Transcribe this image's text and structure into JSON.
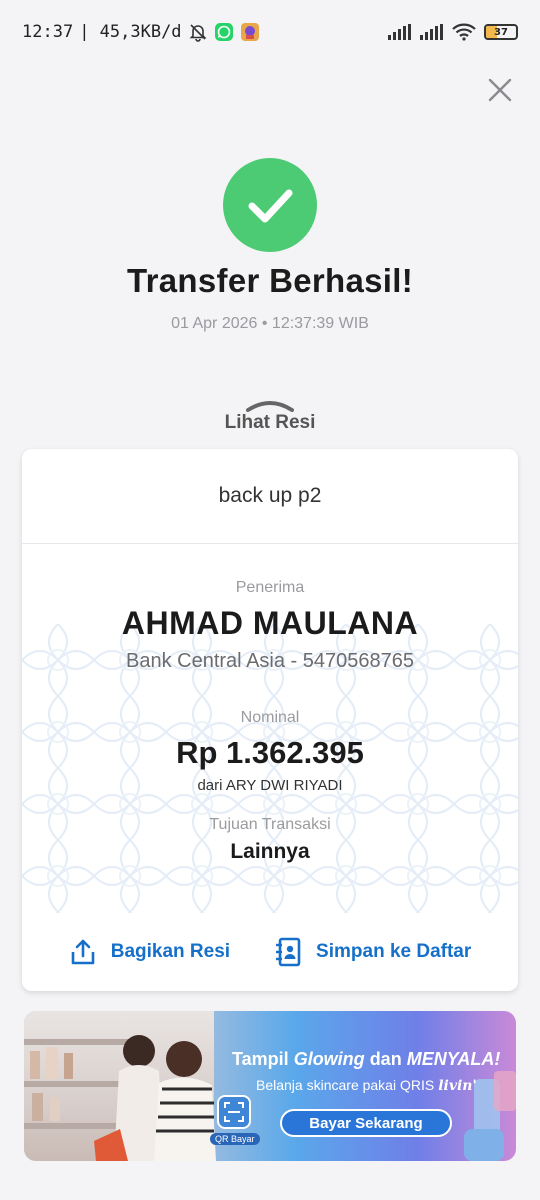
{
  "status_bar": {
    "time": "12:37",
    "speed": "| 45,3KB/d",
    "battery": "37",
    "battery_level_percent": 37
  },
  "header": {
    "title": "Transfer Berhasil!",
    "datetime": "01 Apr 2026 • 12:37:39 WIB"
  },
  "receipt_toggle": {
    "label": "Lihat Resi"
  },
  "receipt": {
    "note": "back up p2",
    "recipient_label": "Penerima",
    "recipient_name": "AHMAD MAULANA",
    "bank_info": "Bank Central Asia - 5470568765",
    "amount_label": "Nominal",
    "amount": "Rp 1.362.395",
    "from": "dari ARY DWI RIYADI",
    "purpose_label": "Tujuan Transaksi",
    "purpose": "Lainnya"
  },
  "actions": {
    "share_label": "Bagikan Resi",
    "save_label": "Simpan ke Daftar"
  },
  "banner": {
    "headline_prefix": "Tampil ",
    "headline_italic": "Glowing",
    "headline_mid": " dan ",
    "headline_bold": "MENYALA!",
    "subline": "Belanja skincare pakai QRIS",
    "brand": "livin'",
    "qr_label": "QR Bayar",
    "button": "Bayar Sekarang"
  },
  "colors": {
    "success": "#4ccb74",
    "accent_blue": "#1670c9",
    "background": "#f4f4f6"
  }
}
